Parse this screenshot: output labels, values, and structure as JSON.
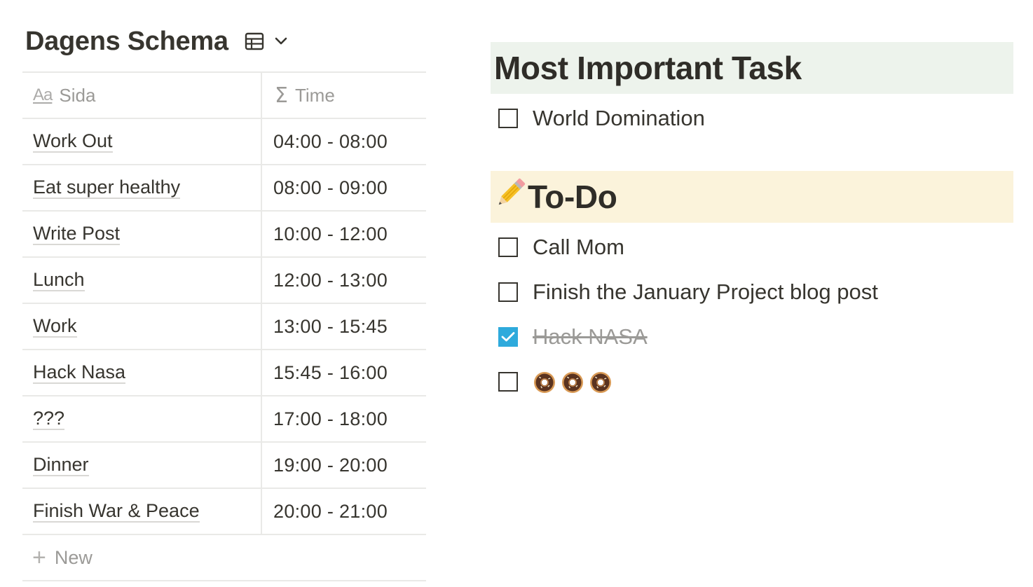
{
  "database": {
    "title": "Dagens Schema",
    "view_icon": "table-icon",
    "dropdown_icon": "chevron-down-icon",
    "columns": [
      {
        "label": "Sida",
        "icon": "text-property-icon"
      },
      {
        "label": "Time",
        "icon": "formula-sigma-icon"
      }
    ],
    "rows": [
      {
        "name": "Work Out",
        "time": "04:00 - 08:00"
      },
      {
        "name": "Eat super healthy",
        "time": "08:00 - 09:00"
      },
      {
        "name": "Write Post",
        "time": "10:00 - 12:00"
      },
      {
        "name": "Lunch",
        "time": "12:00 - 13:00"
      },
      {
        "name": "Work",
        "time": "13:00 - 15:45"
      },
      {
        "name": "Hack Nasa",
        "time": "15:45 - 16:00"
      },
      {
        "name": "???",
        "time": "17:00 - 18:00"
      },
      {
        "name": "Dinner",
        "time": "19:00 - 20:00"
      },
      {
        "name": "Finish War & Peace",
        "time": "20:00 - 21:00"
      }
    ],
    "new_label": "New"
  },
  "mit": {
    "heading": "Most Important Task",
    "heading_color": "#edf3ec",
    "items": [
      {
        "text": "World Domination",
        "checked": false
      }
    ]
  },
  "todo": {
    "heading": "To-Do",
    "heading_icon": "pencil-icon",
    "heading_color": "#fbf3db",
    "items": [
      {
        "text": "Call Mom",
        "checked": false
      },
      {
        "text": "Finish the January Project blog post",
        "checked": false
      },
      {
        "text": "Hack NASA",
        "checked": true
      },
      {
        "text": "",
        "icons": [
          "donut-icon",
          "donut-icon",
          "donut-icon"
        ],
        "checked": false
      }
    ]
  },
  "colors": {
    "text": "#37352f",
    "muted": "#9b9a97",
    "checkbox_checked": "#2eaadc",
    "border": "#e9e9e7"
  }
}
